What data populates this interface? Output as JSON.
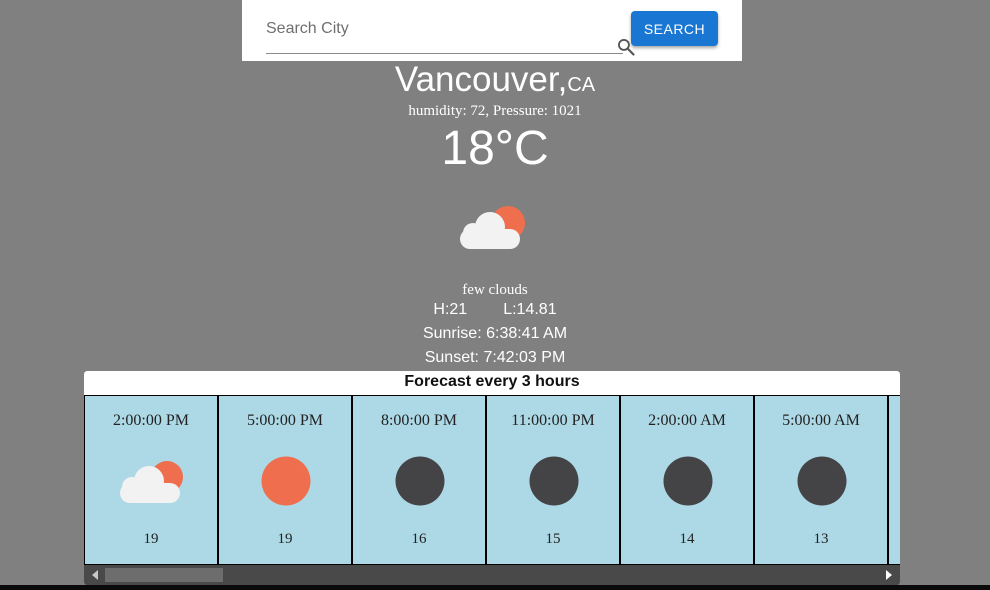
{
  "search": {
    "placeholder": "Search City",
    "button_label": "SEARCH"
  },
  "current": {
    "city": "Vancouver,",
    "country": "CA",
    "meta": "humidity: 72, Pressure: 1021",
    "temperature": "18°C",
    "icon": "few-clouds-icon",
    "description": "few clouds",
    "high": "H:21",
    "low": "L:14.81",
    "sunrise": "Sunrise: 6:38:41 AM",
    "sunset": "Sunset: 7:42:03 PM"
  },
  "forecast": {
    "title": "Forecast every 3 hours",
    "items": [
      {
        "time": "2:00:00 PM",
        "icon": "few-clouds-icon",
        "temp": "19"
      },
      {
        "time": "5:00:00 PM",
        "icon": "sun-icon",
        "temp": "19"
      },
      {
        "time": "8:00:00 PM",
        "icon": "moon-icon",
        "temp": "16"
      },
      {
        "time": "11:00:00 PM",
        "icon": "moon-icon",
        "temp": "15"
      },
      {
        "time": "2:00:00 AM",
        "icon": "moon-icon",
        "temp": "14"
      },
      {
        "time": "5:00:00 AM",
        "icon": "moon-icon",
        "temp": "13"
      }
    ]
  },
  "colors": {
    "background": "#808080",
    "accent": "#1976d2",
    "card": "#add8e6",
    "sun": "#ee6e4d",
    "moon": "#444447",
    "cloud": "#f2f2f2"
  }
}
